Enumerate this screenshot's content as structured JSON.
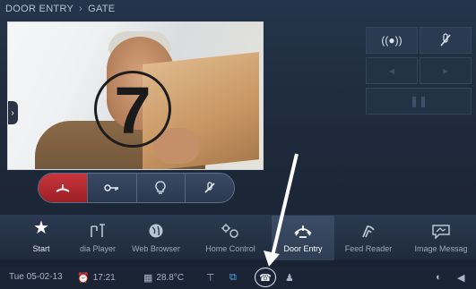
{
  "breadcrumb": {
    "section": "DOOR ENTRY",
    "separator": "›",
    "current": "GATE"
  },
  "video": {
    "edge_tab_icon": "chevron-right-icon",
    "callout_number": "7"
  },
  "call_controls": [
    {
      "name": "hang-up",
      "icon": "phone-hangup-icon",
      "glyph": "⏜"
    },
    {
      "name": "key",
      "icon": "key-icon",
      "glyph": "⚷"
    },
    {
      "name": "light",
      "icon": "lightbulb-icon",
      "glyph": "💡"
    },
    {
      "name": "mute",
      "icon": "mic-off-icon",
      "glyph": "✕"
    }
  ],
  "side_buttons": [
    {
      "name": "alarm",
      "icon": "siren-icon",
      "glyph": "((•))"
    },
    {
      "name": "mic-off",
      "icon": "mic-off-icon",
      "glyph": "🎙"
    }
  ],
  "apps": [
    {
      "label": "Start",
      "icon": "star-icon",
      "glyph": "★"
    },
    {
      "label": "dia Player",
      "icon": "media-player-icon",
      "glyph": "♫"
    },
    {
      "label": "Web Browser",
      "icon": "globe-icon",
      "glyph": "◍"
    },
    {
      "label": "Home Control",
      "icon": "home-control-icon",
      "glyph": "⚙"
    },
    {
      "label": "Door Entry",
      "icon": "door-entry-icon",
      "glyph": "⏏"
    },
    {
      "label": "Feed Reader",
      "icon": "feed-icon",
      "glyph": "◠"
    },
    {
      "label": "Image Messag",
      "icon": "image-message-icon",
      "glyph": "✉"
    }
  ],
  "status": {
    "date": "Tue 05-02-13",
    "time": "17:21",
    "temperature": "28.8°C"
  },
  "colors": {
    "accent_red": "#b52a30",
    "background": "#1e2a3b",
    "active_app": "#3b4c66"
  }
}
